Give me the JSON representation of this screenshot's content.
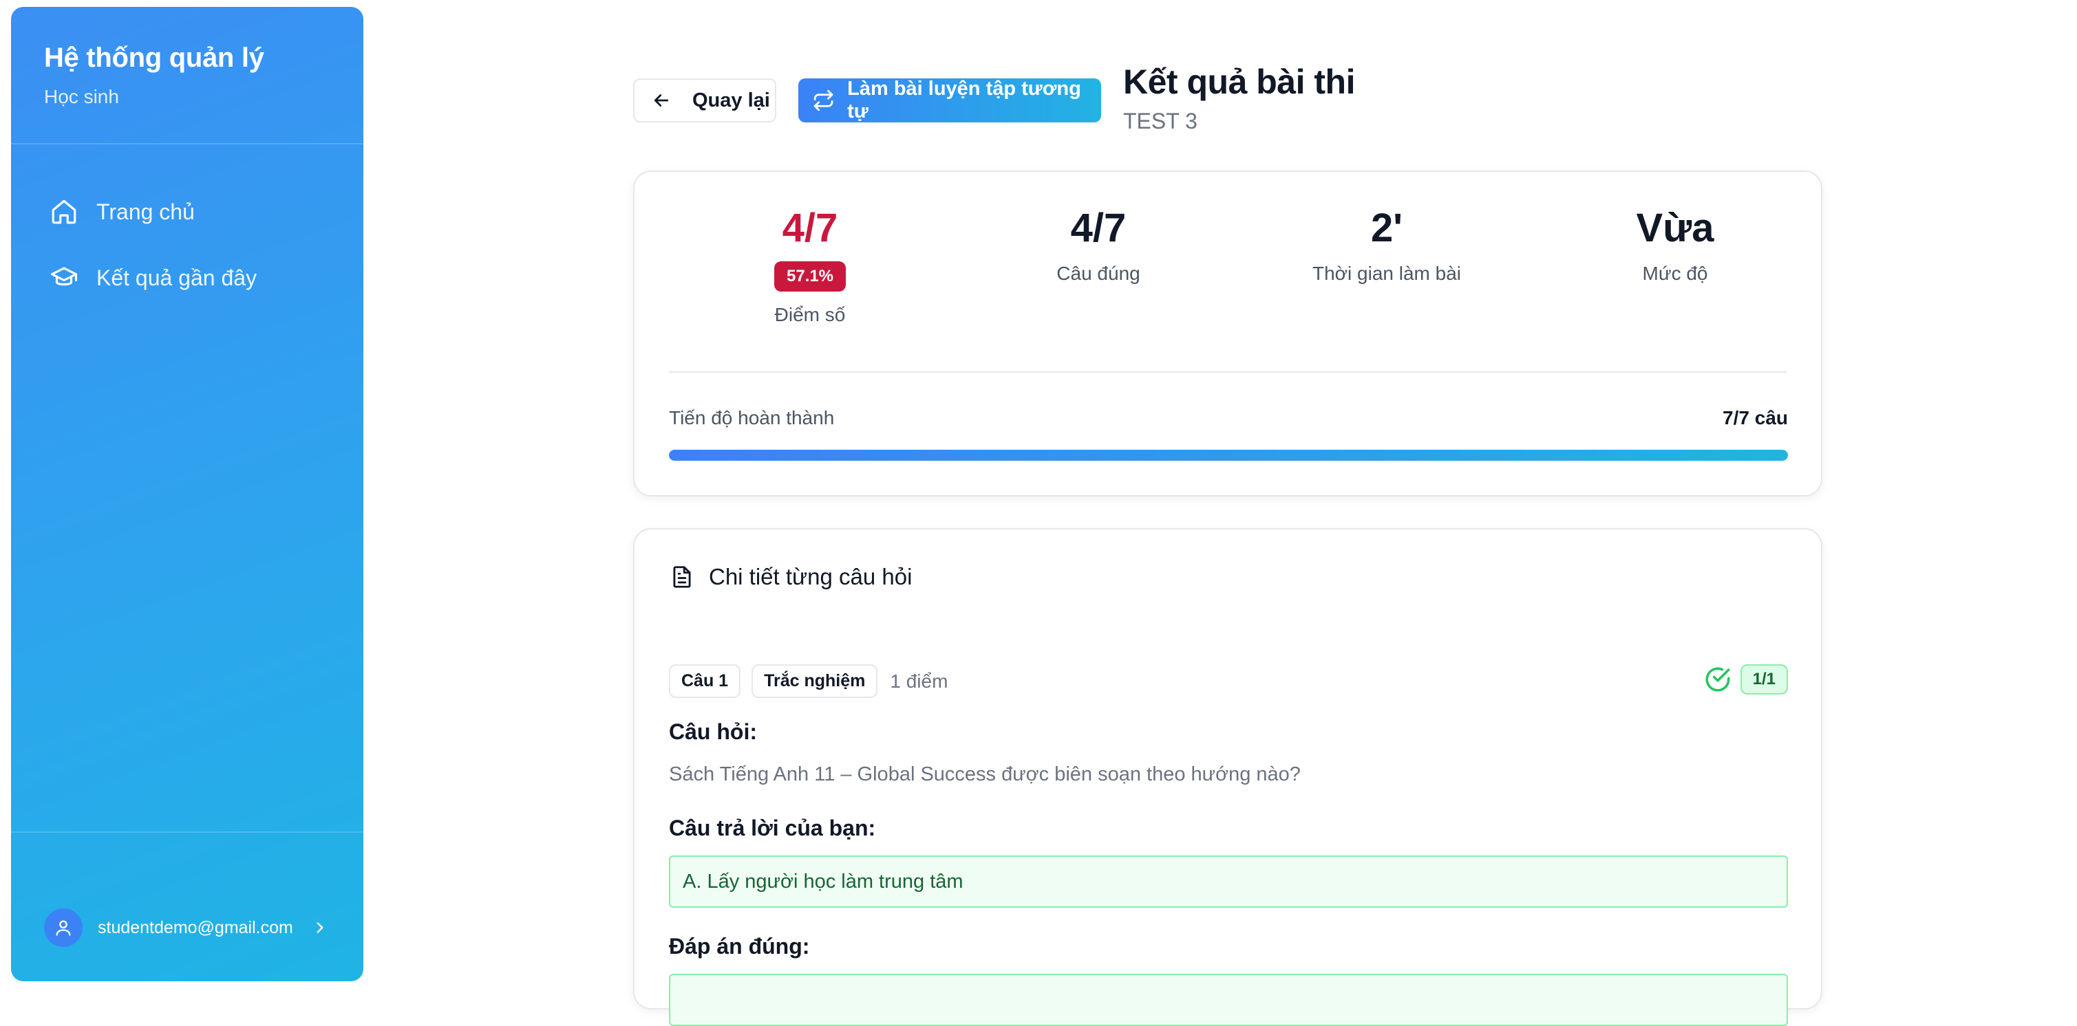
{
  "sidebar": {
    "title": "Hệ thống quản lý",
    "subtitle": "Học sinh",
    "nav": [
      {
        "label": "Trang chủ",
        "icon": "home-icon"
      },
      {
        "label": "Kết quả gần đây",
        "icon": "graduation-cap-icon"
      }
    ],
    "user": {
      "email": "studentdemo@gmail.com"
    }
  },
  "header": {
    "back_label": "Quay lại",
    "practice_label": "Làm bài luyện tập tương tự",
    "title": "Kết quả bài thi",
    "subtitle": "TEST 3"
  },
  "stats": {
    "score": {
      "value": "4/7",
      "percent": "57.1%",
      "label": "Điểm số"
    },
    "correct": {
      "value": "4/7",
      "label": "Câu đúng"
    },
    "time": {
      "value": "2'",
      "label": "Thời gian làm bài"
    },
    "level": {
      "value": "Vừa",
      "label": "Mức độ"
    },
    "progress": {
      "label": "Tiến độ hoàn thành",
      "value": "7/7 câu",
      "fraction": 1.0
    }
  },
  "detail": {
    "heading": "Chi tiết từng câu hỏi",
    "question": {
      "number": "Câu 1",
      "type": "Trắc nghiệm",
      "points": "1 điểm",
      "score": "1/1",
      "status": "correct",
      "question_label": "Câu hỏi:",
      "question_text": "Sách Tiếng Anh 11 – Global Success được biên soạn theo hướng nào?",
      "your_answer_label": "Câu trả lời của bạn:",
      "your_answer": "A. Lấy người học làm trung tâm",
      "correct_answer_label": "Đáp án đúng:"
    }
  },
  "colors": {
    "accent": "#3b82f6",
    "score_red": "#c8193c",
    "success": "#22c55e"
  }
}
